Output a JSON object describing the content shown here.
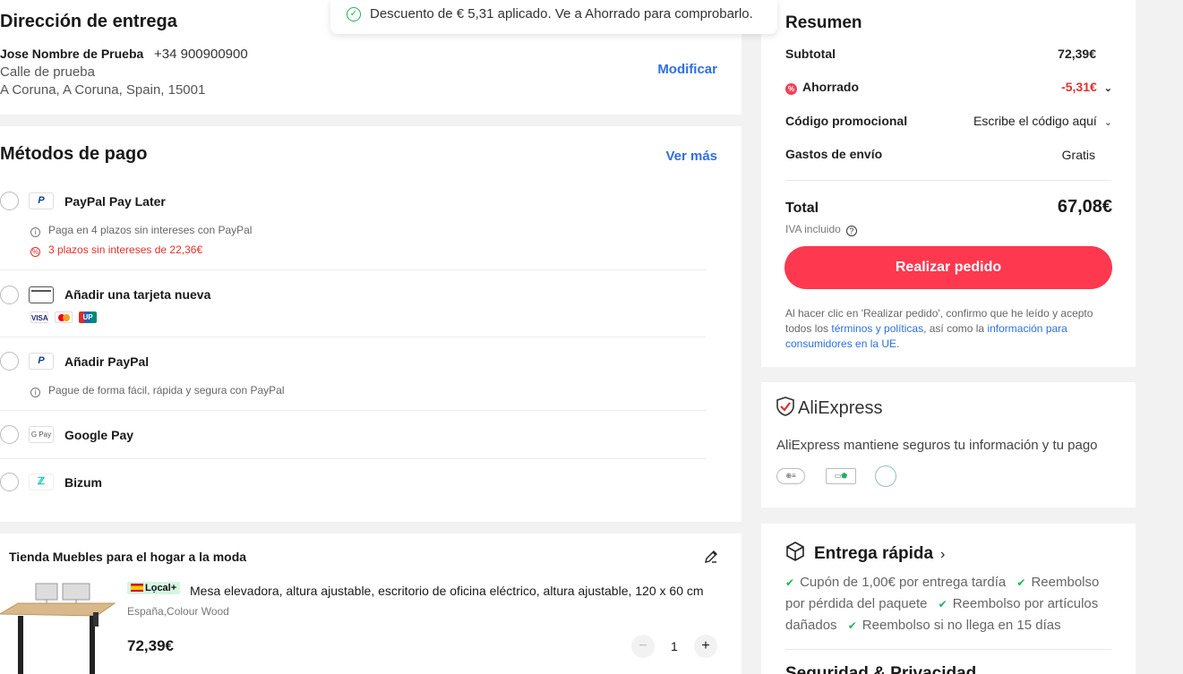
{
  "toast": {
    "message": "Descuento de € 5,31 aplicado. Ve a Ahorrado para comprobarlo."
  },
  "address": {
    "title": "Dirección de entrega",
    "name": "Jose Nombre de Prueba",
    "phone": "+34 900900900",
    "line1": "Calle de prueba",
    "line2": "A Coruna, A Coruna, Spain, 15001",
    "modify_label": "Modificar"
  },
  "payment": {
    "title": "Métodos de pago",
    "more_label": "Ver más",
    "methods": [
      {
        "label": "PayPal Pay Later",
        "icon": "P",
        "sub1": "Paga en 4 plazos sin intereses con PayPal",
        "sub2": "3 plazos sin intereses de 22,36€"
      },
      {
        "label": "Añadir una tarjeta nueva",
        "cards": [
          "VISA",
          "MC",
          "UP"
        ]
      },
      {
        "label": "Añadir PayPal",
        "icon": "P",
        "sub1": "Pague de forma fácil, rápida y segura con PayPal"
      },
      {
        "label": "Google Pay",
        "icon": "G Pay"
      },
      {
        "label": "Bizum",
        "icon": "ℤ"
      }
    ]
  },
  "store": {
    "name": "Tienda Muebles para el hogar a la moda",
    "badge": "Lọcal+",
    "product_title": "Mesa elevadora, altura ajustable, escritorio de oficina eléctrico, altura ajustable, 120 x 60 cm",
    "variant": "España,Colour Wood",
    "price": "72,39€",
    "quantity": "1"
  },
  "summary": {
    "title": "Resumen",
    "subtotal_label": "Subtotal",
    "subtotal_value": "72,39€",
    "saved_label": "Ahorrado",
    "saved_value": "-5,31€",
    "promo_label": "Código promocional",
    "promo_value": "Escribe el código aquí",
    "shipping_label": "Gastos de envío",
    "shipping_value": "Gratis",
    "total_label": "Total",
    "total_value": "67,08€",
    "iva_label": "IVA incluido",
    "order_button": "Realizar pedido",
    "legal_pre": "Al hacer clic en 'Realizar pedido', confirmo que he leído y acepto todos los ",
    "legal_link1": "términos y políticas",
    "legal_mid": ", así como la ",
    "legal_link2": "información para consumidores en la UE",
    "legal_post": "."
  },
  "security": {
    "logo_text": "AliExpress",
    "text": "AliExpress mantiene seguros tu información y tu pago"
  },
  "delivery": {
    "title": "Entrega rápida",
    "features": [
      "Cupón de 1,00€ por entrega tardía",
      "Reembolso por pérdida del paquete",
      "Reembolso por artículos dañados",
      "Reembolso si no llega en 15 días"
    ],
    "next_section": "Seguridad & Privacidad"
  },
  "colors": {
    "accent": "#fd384f",
    "link": "#2e6fe0",
    "success": "#1fb35a",
    "discount": "#e0302d"
  }
}
